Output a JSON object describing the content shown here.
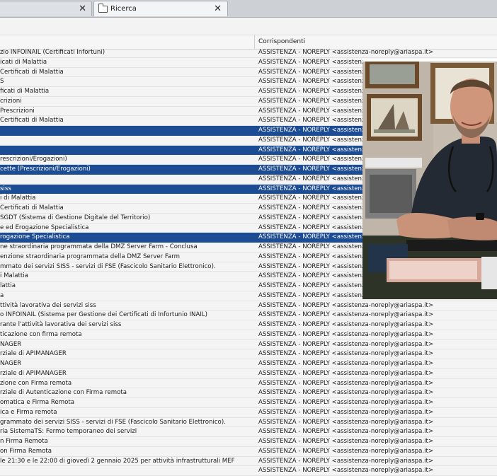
{
  "tabs": [
    {
      "label": "",
      "active": false
    },
    {
      "label": "Ricerca",
      "active": true
    }
  ],
  "column_headers": {
    "correspondents": "Corrispondenti"
  },
  "rows": [
    {
      "subject": "zio INFOINAIL (Certificati Infortuni)",
      "correspondent": "ASSISTENZA - NOREPLY <assistenza-noreply@ariaspa.it>",
      "selected": false
    },
    {
      "subject": "icati di Malattia",
      "correspondent": "ASSISTENZA - NOREPLY <assistenza-noreply@ariaspa.it>",
      "selected": false
    },
    {
      "subject": "Certificati di Malattia",
      "correspondent": "ASSISTENZA - NOREPLY <assistenza-noreply@ariaspa.it>",
      "selected": false
    },
    {
      "subject": "S",
      "correspondent": "ASSISTENZA - NOREPLY <assistenza-noreply@ariaspa.it>",
      "selected": false
    },
    {
      "subject": "ficati di Malattia",
      "correspondent": "ASSISTENZA - NOREPLY <assistenza-noreply@ariaspa.it>",
      "selected": false
    },
    {
      "subject": "crizioni",
      "correspondent": "ASSISTENZA - NOREPLY <assistenza-noreply@ariaspa.it>",
      "selected": false
    },
    {
      "subject": "Prescrizioni",
      "correspondent": "ASSISTENZA - NOREPLY <assistenza-noreply@ariaspa.it>",
      "selected": false
    },
    {
      "subject": "Certificati di Malattia",
      "correspondent": "ASSISTENZA - NOREPLY <assistenza-noreply@ariaspa.it>",
      "selected": false
    },
    {
      "subject": "",
      "correspondent": "ASSISTENZA - NOREPLY <assistenza-noreply@ariaspa.it>",
      "selected": true
    },
    {
      "subject": "",
      "correspondent": "ASSISTENZA - NOREPLY <assistenza-noreply@ariaspa.it>",
      "selected": false
    },
    {
      "subject": "",
      "correspondent": "ASSISTENZA - NOREPLY <assistenza-noreply@ariaspa.it>",
      "selected": true
    },
    {
      "subject": "rescrizioni/Erogazioni)",
      "correspondent": "ASSISTENZA - NOREPLY <assistenza-noreply@ariaspa.it>",
      "selected": false
    },
    {
      "subject": "cette (Prescrizioni/Erogazioni)",
      "correspondent": "ASSISTENZA - NOREPLY <assistenza-noreply@ariaspa.it>",
      "selected": true
    },
    {
      "subject": "",
      "correspondent": "ASSISTENZA - NOREPLY <assistenza-noreply@ariaspa.it>",
      "selected": false
    },
    {
      "subject": "siss",
      "correspondent": "ASSISTENZA - NOREPLY <assistenza-noreply@ariaspa.it>",
      "selected": true
    },
    {
      "subject": "i di Malattia",
      "correspondent": "ASSISTENZA - NOREPLY <assistenza-noreply@ariaspa.it>",
      "selected": false
    },
    {
      "subject": "Certificati di Malattia",
      "correspondent": "ASSISTENZA - NOREPLY <assistenza-noreply@ariaspa.it>",
      "selected": false
    },
    {
      "subject": "SGDT (Sistema di Gestione Digitale del Territorio)",
      "correspondent": "ASSISTENZA - NOREPLY <assistenza-noreply@ariaspa.it>",
      "selected": false
    },
    {
      "subject": "e ed Erogazione Specialistica",
      "correspondent": "ASSISTENZA - NOREPLY <assistenza-noreply@ariaspa.it>",
      "selected": false
    },
    {
      "subject": "rogazione Specialistica",
      "correspondent": "ASSISTENZA - NOREPLY <assistenza-noreply@ariaspa.it>",
      "selected": true
    },
    {
      "subject": "ne straordinaria programmata della DMZ Server Farm - Conclusa",
      "correspondent": "ASSISTENZA - NOREPLY <assistenza-noreply@ariaspa.it>",
      "selected": false
    },
    {
      "subject": "enzione straordinaria programmata della DMZ Server Farm",
      "correspondent": "ASSISTENZA - NOREPLY <assistenza-noreply@ariaspa.it>",
      "selected": false
    },
    {
      "subject": "mmato dei servizi SISS - servizi di FSE (Fascicolo Sanitario Elettronico).",
      "correspondent": "ASSISTENZA - NOREPLY <assistenza-noreply@ariaspa.it>",
      "selected": false
    },
    {
      "subject": "i Malattia",
      "correspondent": "ASSISTENZA - NOREPLY <assistenza-noreply@ariaspa.it>",
      "selected": false
    },
    {
      "subject": "lattia",
      "correspondent": "ASSISTENZA - NOREPLY <assistenza-noreply@ariaspa.it>",
      "selected": false
    },
    {
      "subject": "a",
      "correspondent": "ASSISTENZA - NOREPLY <assistenza-noreply@ariaspa.it>",
      "selected": false
    },
    {
      "subject": "ttività lavorativa dei servizi siss",
      "correspondent": "ASSISTENZA - NOREPLY <assistenza-noreply@ariaspa.it>",
      "selected": false
    },
    {
      "subject": "o INFOINAIL (Sistema per Gestione dei Certificati di Infortunio INAIL)",
      "correspondent": "ASSISTENZA - NOREPLY <assistenza-noreply@ariaspa.it>",
      "selected": false
    },
    {
      "subject": "rante l'attività lavorativa dei servizi siss",
      "correspondent": "ASSISTENZA - NOREPLY <assistenza-noreply@ariaspa.it>",
      "selected": false
    },
    {
      "subject": "ticazione con firma remota",
      "correspondent": "ASSISTENZA - NOREPLY <assistenza-noreply@ariaspa.it>",
      "selected": false
    },
    {
      "subject": "NAGER",
      "correspondent": "ASSISTENZA - NOREPLY <assistenza-noreply@ariaspa.it>",
      "selected": false
    },
    {
      "subject": "rziale di APIMANAGER",
      "correspondent": "ASSISTENZA - NOREPLY <assistenza-noreply@ariaspa.it>",
      "selected": false
    },
    {
      "subject": "NAGER",
      "correspondent": "ASSISTENZA - NOREPLY <assistenza-noreply@ariaspa.it>",
      "selected": false
    },
    {
      "subject": "rziale di APIMANAGER",
      "correspondent": "ASSISTENZA - NOREPLY <assistenza-noreply@ariaspa.it>",
      "selected": false
    },
    {
      "subject": "zione con Firma remota",
      "correspondent": "ASSISTENZA - NOREPLY <assistenza-noreply@ariaspa.it>",
      "selected": false
    },
    {
      "subject": "rziale di Autenticazione con Firma remota",
      "correspondent": "ASSISTENZA - NOREPLY <assistenza-noreply@ariaspa.it>",
      "selected": false
    },
    {
      "subject": "omatica e Firma Remota",
      "correspondent": "ASSISTENZA - NOREPLY <assistenza-noreply@ariaspa.it>",
      "selected": false
    },
    {
      "subject": "ica e Firma remota",
      "correspondent": "ASSISTENZA - NOREPLY <assistenza-noreply@ariaspa.it>",
      "selected": false
    },
    {
      "subject": "grammato dei servizi SISS - servizi di FSE (Fascicolo Sanitario Elettronico).",
      "correspondent": "ASSISTENZA - NOREPLY <assistenza-noreply@ariaspa.it>",
      "selected": false
    },
    {
      "subject": "ria SistemaTS: Fermo temporaneo dei servizi",
      "correspondent": "ASSISTENZA - NOREPLY <assistenza-noreply@ariaspa.it>",
      "selected": false
    },
    {
      "subject": "n Firma Remota",
      "correspondent": "ASSISTENZA - NOREPLY <assistenza-noreply@ariaspa.it>",
      "selected": false
    },
    {
      "subject": "on Firma Remota",
      "correspondent": "ASSISTENZA - NOREPLY <assistenza-noreply@ariaspa.it>",
      "selected": false
    },
    {
      "subject": "le 21:30 e le 22:00 di giovedì 2 gennaio 2025 per attività infrastrutturali MEF",
      "correspondent": "ASSISTENZA - NOREPLY <assistenza-noreply@ariaspa.it>",
      "selected": false
    },
    {
      "subject": "",
      "correspondent": "ASSISTENZA - NOREPLY <assistenza-noreply@ariaspa.it>",
      "selected": false
    }
  ],
  "icons": {
    "tab_close": "close-icon",
    "tab_folder": "folder-icon"
  },
  "colors": {
    "selection": "#1c4c94",
    "tab_strip": "#cdd1d6",
    "background": "#f4f4f4"
  }
}
